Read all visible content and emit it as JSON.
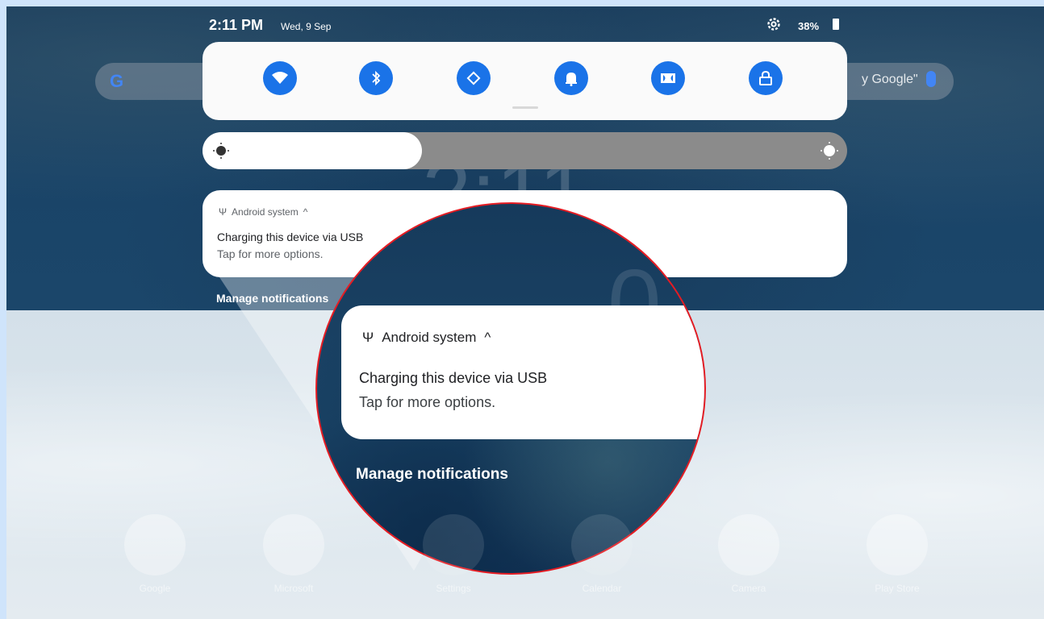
{
  "status_bar": {
    "time": "2:11 PM",
    "date": "Wed, 9 Sep",
    "battery": "38%"
  },
  "background": {
    "search_hint": "y Google\"",
    "dock": [
      {
        "label": "Google",
        "icon": "google-folder-icon"
      },
      {
        "label": "Microsoft",
        "icon": "microsoft-folder-icon"
      },
      {
        "label": "Settings",
        "icon": "settings-app-icon"
      },
      {
        "label": "Calendar",
        "icon": "calendar-app-icon"
      },
      {
        "label": "Camera",
        "icon": "camera-app-icon"
      },
      {
        "label": "Play Store",
        "icon": "play-store-icon"
      }
    ]
  },
  "quick_settings": {
    "tiles": [
      {
        "name": "wifi",
        "icon": "wifi-icon",
        "active": true
      },
      {
        "name": "bluetooth",
        "icon": "bluetooth-icon",
        "active": true
      },
      {
        "name": "auto-rotate",
        "icon": "rotate-icon",
        "active": true
      },
      {
        "name": "sound",
        "icon": "bell-icon",
        "active": true
      },
      {
        "name": "dolby",
        "icon": "dolby-icon",
        "active": true
      },
      {
        "name": "lock",
        "icon": "lock-icon",
        "active": true
      }
    ],
    "brightness_level": 0.34
  },
  "notification": {
    "app": "Android system",
    "title": "Charging this device via USB",
    "text": "Tap for more options."
  },
  "manage_label": "Manage notifications",
  "magnifier": {
    "app": "Android system",
    "title": "Charging this device via USB",
    "text": "Tap for more options.",
    "manage_label": "Manage notifications"
  },
  "colors": {
    "accent": "#1a73e8",
    "highlight_ring": "#e51c23"
  }
}
